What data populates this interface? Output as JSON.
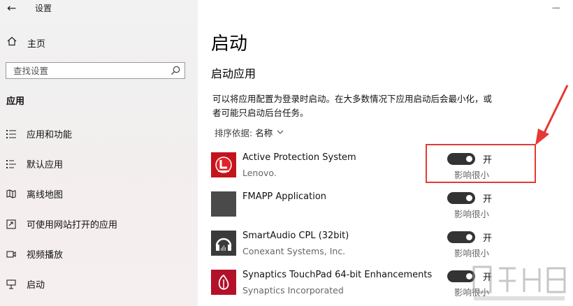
{
  "window": {
    "title": "设置",
    "back_icon": "back-arrow-icon"
  },
  "sidebar": {
    "home_label": "主页",
    "search_placeholder": "查找设置",
    "section_heading": "应用",
    "items": [
      {
        "label": "应用和功能",
        "icon": "apps-features-icon"
      },
      {
        "label": "默认应用",
        "icon": "default-apps-icon"
      },
      {
        "label": "离线地图",
        "icon": "offline-maps-icon"
      },
      {
        "label": "可使用网站打开的应用",
        "icon": "apps-for-websites-icon"
      },
      {
        "label": "视频播放",
        "icon": "video-playback-icon"
      },
      {
        "label": "启动",
        "icon": "startup-icon"
      }
    ]
  },
  "main": {
    "title": "启动",
    "subtitle": "启动应用",
    "description": "可以将应用配置为登录时启动。在大多数情况下应用启动后会最小化，或者可能只启动后台任务。",
    "sort_label": "排序依据:",
    "sort_value": "名称",
    "apps": [
      {
        "name": "Active Protection System",
        "publisher": "Lenovo.",
        "toggle_label": "开",
        "impact": "影响很小",
        "enabled": true
      },
      {
        "name": "FMAPP Application",
        "publisher": "",
        "toggle_label": "开",
        "impact": "影响很小",
        "enabled": true
      },
      {
        "name": "SmartAudio CPL (32bit)",
        "publisher": "Conexant Systems, Inc.",
        "toggle_label": "开",
        "impact": "影响很小",
        "enabled": true
      },
      {
        "name": "Synaptics TouchPad 64-bit Enhancements",
        "publisher": "Synaptics Incorporated",
        "toggle_label": "开",
        "impact": "影响很小",
        "enabled": true
      }
    ]
  },
  "colors": {
    "annotation": "#e53935",
    "toggle_on": "#333333",
    "lenovo_red": "#c4141b",
    "synaptics_red": "#b3102a"
  }
}
